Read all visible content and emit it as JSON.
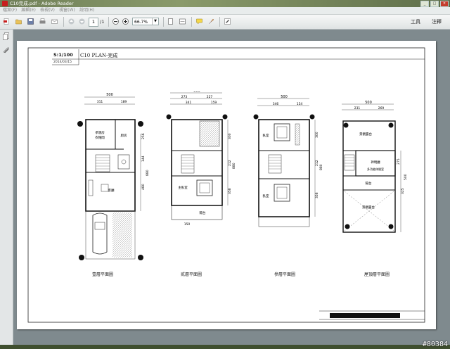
{
  "window": {
    "title": "C10完成.pdf - Adobe Reader"
  },
  "menu": {
    "items": [
      "檔案(F)",
      "編輯(E)",
      "檢視(V)",
      "視窗(W)",
      "說明(H)"
    ]
  },
  "toolbar": {
    "page_current": "1",
    "page_total": "/1",
    "zoom": "66.7%",
    "tools_label": "工具",
    "comment_label": "注釋"
  },
  "document": {
    "scale": "S:1/100",
    "date": "2014/03/15",
    "plan_title": "C10 PLAN-完成",
    "floors": [
      {
        "name": "壹層平面圖",
        "dims_top": [
          "500",
          "311",
          "189"
        ],
        "dims_side": [
          "256",
          "144",
          "480",
          "880"
        ],
        "rooms": [
          "孝親房",
          "衣帽間",
          "廚房",
          "客廳"
        ]
      },
      {
        "name": "貳層平面圖",
        "dims_top": [
          "500",
          "273",
          "227",
          "341",
          "159"
        ],
        "dims_side": [
          "300",
          "212",
          "880",
          "358",
          "150"
        ],
        "rooms": [
          "主臥室",
          "陽台"
        ]
      },
      {
        "name": "參層平面圖",
        "dims_top": [
          "500",
          "346",
          "154"
        ],
        "dims_side": [
          "300",
          "212",
          "880",
          "358"
        ],
        "rooms": [
          "臥室",
          "臥室"
        ]
      },
      {
        "name": "屋頂層平面圖",
        "dims_top": [
          "500",
          "231",
          "269"
        ],
        "dims_side": [
          "275",
          "325",
          "500"
        ],
        "rooms": [
          "景觀露台",
          "神明廳",
          "多功能休閒室",
          "陽台",
          "景觀露台"
        ]
      }
    ]
  },
  "watermark": "#80384",
  "colors": {
    "titlebar": "#7a8a5e",
    "toolbar": "#e6e9ea",
    "viewer": "#7f8a8e",
    "paper": "#ffffff",
    "acrobat_red": "#c81e1e"
  },
  "icons": [
    "create-pdf-icon",
    "open-icon",
    "save-icon",
    "print-icon",
    "email-icon",
    "prev-page-icon",
    "next-page-icon",
    "zoom-out-icon",
    "zoom-in-icon",
    "fit-page-icon",
    "fit-width-icon",
    "comment-icon",
    "highlight-icon",
    "sign-icon"
  ]
}
